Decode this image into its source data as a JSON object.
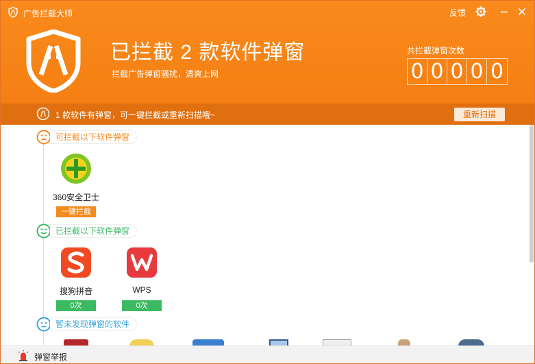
{
  "window": {
    "title": "广告拦截大师",
    "feedback_label": "反馈",
    "icons": {
      "settings": "gear-icon",
      "minimize": "minimize-icon",
      "close": "close-icon"
    }
  },
  "hero": {
    "title": "已拦截 2 款软件弹窗",
    "subtitle": "拦截广告弹窗骚扰，清爽上网",
    "counter_label": "共拦截弹窗次数",
    "counter_digits": [
      "0",
      "0",
      "0",
      "0",
      "0"
    ]
  },
  "infobar": {
    "text": "1 款软件有弹窗，可一键拦截或重新扫描哦~",
    "rescan_label": "重新扫描"
  },
  "sections": {
    "blockable": {
      "label": "可拦截以下软件弹窗",
      "apps": [
        {
          "name": "360安全卫士",
          "action": "一键拦截"
        }
      ]
    },
    "blocked": {
      "label": "已拦截以下软件弹窗",
      "apps": [
        {
          "name": "搜狗拼音",
          "count": "0次"
        },
        {
          "name": "WPS",
          "count": "0次"
        }
      ]
    },
    "none": {
      "label": "暂未发现弹窗的软件"
    }
  },
  "footer": {
    "report_label": "弹窗举报"
  },
  "colors": {
    "header": "#f5801a",
    "infobar": "#e06f10",
    "orange_badge": "#f28a1e",
    "green_badge": "#3cba62",
    "blue_label": "#3aa4d8"
  }
}
